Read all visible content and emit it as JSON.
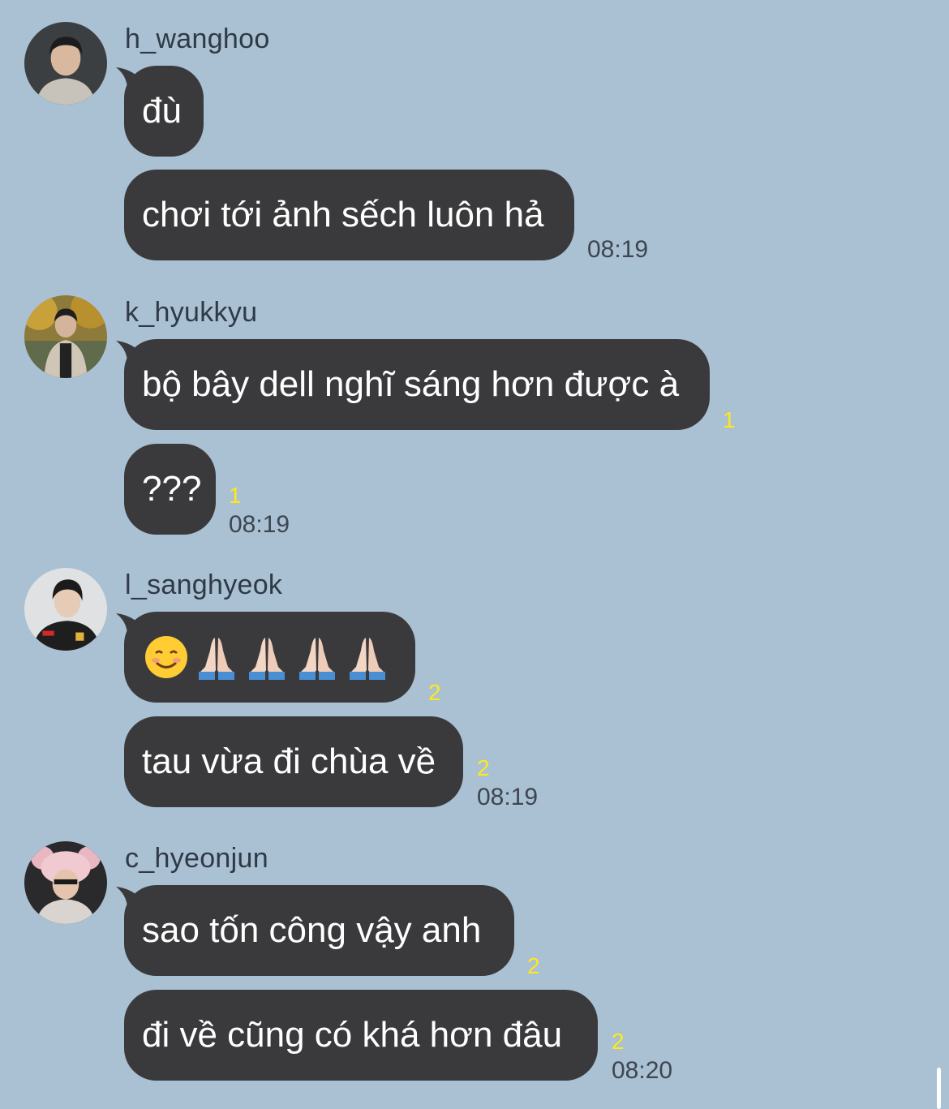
{
  "colors": {
    "background": "#aac0d3",
    "bubble": "#3a3a3c",
    "bubble_text": "#ffffff",
    "unread": "#ffe81a",
    "time": "#3d4650"
  },
  "groups": [
    {
      "sender": "h_wanghoo",
      "avatar_icon": "user-avatar-photo",
      "messages": [
        {
          "text": "đù",
          "unread": ""
        },
        {
          "text": "chơi tới ảnh sếch luôn hả",
          "unread": ""
        }
      ],
      "time": "08:19"
    },
    {
      "sender": "k_hyukkyu",
      "avatar_icon": "user-avatar-photo",
      "messages": [
        {
          "text": "bộ bây dell nghĩ sáng hơn được à",
          "unread": "1"
        },
        {
          "text": "???",
          "unread": "1"
        }
      ],
      "time": "08:19"
    },
    {
      "sender": "l_sanghyeok",
      "avatar_icon": "user-avatar-photo",
      "messages": [
        {
          "text": "☺️🙏🏻🙏🏻🙏🏻🙏🏻",
          "emoji_icons": [
            "smiling-face-icon",
            "folded-hands-icon",
            "folded-hands-icon",
            "folded-hands-icon",
            "folded-hands-icon"
          ],
          "unread": "2"
        },
        {
          "text": "tau vừa đi chùa về",
          "unread": "2"
        }
      ],
      "time": "08:19"
    },
    {
      "sender": "c_hyeonjun",
      "avatar_icon": "user-avatar-photo",
      "messages": [
        {
          "text": "sao tốn công vậy anh",
          "unread": "2"
        },
        {
          "text": "đi về cũng có khá hơn đâu",
          "unread": "2"
        }
      ],
      "time": "08:20"
    }
  ]
}
